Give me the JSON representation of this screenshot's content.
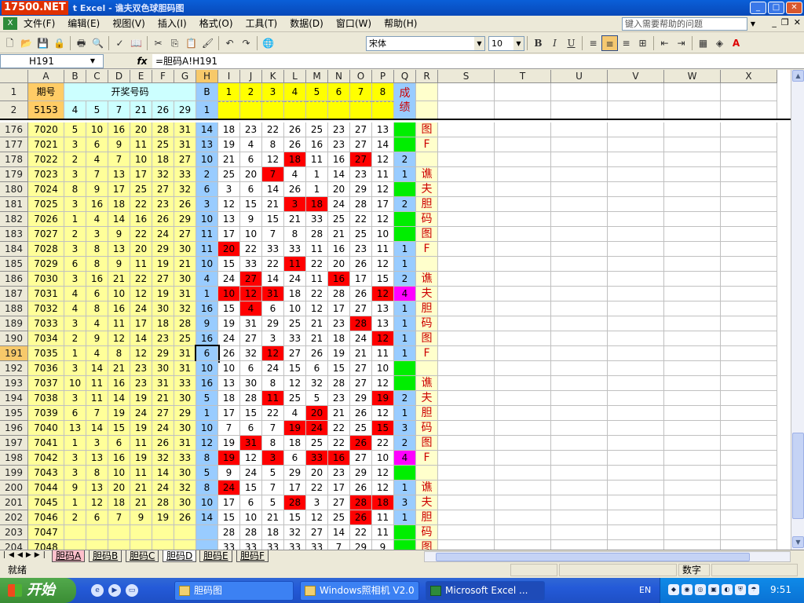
{
  "window": {
    "logo": "17500.NET",
    "title": "t Excel - 谯夫双色球胆码图"
  },
  "menu": [
    "文件(F)",
    "编辑(E)",
    "视图(V)",
    "插入(I)",
    "格式(O)",
    "工具(T)",
    "数据(D)",
    "窗口(W)",
    "帮助(H)"
  ],
  "help_placeholder": "键入需要帮助的问题",
  "toolbar": {
    "font": "宋体",
    "size": "10",
    "bold": "B",
    "italic": "I",
    "underline": "U"
  },
  "name_box": "H191",
  "fx_label": "fx",
  "formula": "=胆码A!H191",
  "col_headers": [
    "A",
    "B",
    "C",
    "D",
    "E",
    "F",
    "G",
    "H",
    "I",
    "J",
    "K",
    "L",
    "M",
    "N",
    "O",
    "P",
    "Q",
    "R",
    "S",
    "T",
    "U",
    "V",
    "W",
    "X"
  ],
  "header_rows": {
    "row1": {
      "num": "1",
      "label": "期号",
      "draw": "开奖号码",
      "H": "B",
      "I_P": [
        "1",
        "2",
        "3",
        "4",
        "5",
        "6",
        "7",
        "8"
      ],
      "Q": "成绩"
    },
    "row2": {
      "num": "2",
      "A": "5153",
      "B_G": [
        "4",
        "5",
        "7",
        "21",
        "26",
        "29"
      ],
      "H": "1"
    }
  },
  "rows": [
    {
      "n": "176",
      "a": "7020",
      "d": [
        "5",
        "10",
        "16",
        "20",
        "28",
        "31"
      ],
      "h": "14",
      "v": [
        "18",
        "23",
        "22",
        "26",
        "25",
        "23",
        "27",
        "13"
      ],
      "q": "",
      "r": "图"
    },
    {
      "n": "177",
      "a": "7021",
      "d": [
        "3",
        "6",
        "9",
        "11",
        "25",
        "31"
      ],
      "h": "13",
      "v": [
        "19",
        "4",
        "8",
        "26",
        "16",
        "23",
        "27",
        "14"
      ],
      "q": "",
      "r": "F"
    },
    {
      "n": "178",
      "a": "7022",
      "d": [
        "2",
        "4",
        "7",
        "10",
        "18",
        "27"
      ],
      "h": "10",
      "v": [
        "21",
        "6",
        "12",
        "18",
        "11",
        "16",
        "27",
        "12"
      ],
      "q": "2",
      "r": ""
    },
    {
      "n": "179",
      "a": "7023",
      "d": [
        "3",
        "7",
        "13",
        "17",
        "32",
        "33"
      ],
      "h": "2",
      "v": [
        "25",
        "20",
        "7",
        "4",
        "1",
        "14",
        "23",
        "11"
      ],
      "q": "1",
      "r": "谯"
    },
    {
      "n": "180",
      "a": "7024",
      "d": [
        "8",
        "9",
        "17",
        "25",
        "27",
        "32"
      ],
      "h": "6",
      "v": [
        "3",
        "6",
        "14",
        "26",
        "1",
        "20",
        "29",
        "12"
      ],
      "q": "",
      "r": "夫"
    },
    {
      "n": "181",
      "a": "7025",
      "d": [
        "3",
        "16",
        "18",
        "22",
        "23",
        "26"
      ],
      "h": "3",
      "v": [
        "12",
        "15",
        "21",
        "3",
        "18",
        "24",
        "28",
        "17"
      ],
      "q": "2",
      "r": "胆"
    },
    {
      "n": "182",
      "a": "7026",
      "d": [
        "1",
        "4",
        "14",
        "16",
        "26",
        "29"
      ],
      "h": "10",
      "v": [
        "13",
        "9",
        "15",
        "21",
        "33",
        "25",
        "22",
        "12"
      ],
      "q": "",
      "r": "码"
    },
    {
      "n": "183",
      "a": "7027",
      "d": [
        "2",
        "3",
        "9",
        "22",
        "24",
        "27"
      ],
      "h": "11",
      "v": [
        "17",
        "10",
        "7",
        "8",
        "28",
        "21",
        "25",
        "10"
      ],
      "q": "",
      "r": "图"
    },
    {
      "n": "184",
      "a": "7028",
      "d": [
        "3",
        "8",
        "13",
        "20",
        "29",
        "30"
      ],
      "h": "11",
      "v": [
        "20",
        "22",
        "33",
        "33",
        "11",
        "16",
        "23",
        "11"
      ],
      "q": "1",
      "r": "F"
    },
    {
      "n": "185",
      "a": "7029",
      "d": [
        "6",
        "8",
        "9",
        "11",
        "19",
        "21"
      ],
      "h": "10",
      "v": [
        "15",
        "33",
        "22",
        "11",
        "22",
        "20",
        "26",
        "12"
      ],
      "q": "1",
      "r": ""
    },
    {
      "n": "186",
      "a": "7030",
      "d": [
        "3",
        "16",
        "21",
        "22",
        "27",
        "30"
      ],
      "h": "4",
      "v": [
        "24",
        "27",
        "14",
        "24",
        "11",
        "16",
        "17",
        "15"
      ],
      "q": "2",
      "r": "谯"
    },
    {
      "n": "187",
      "a": "7031",
      "d": [
        "4",
        "6",
        "10",
        "12",
        "19",
        "31"
      ],
      "h": "1",
      "v": [
        "10",
        "12",
        "31",
        "18",
        "22",
        "28",
        "26",
        "12"
      ],
      "q": "4",
      "r": "夫"
    },
    {
      "n": "188",
      "a": "7032",
      "d": [
        "4",
        "8",
        "16",
        "24",
        "30",
        "32"
      ],
      "h": "16",
      "v": [
        "15",
        "4",
        "6",
        "10",
        "12",
        "17",
        "27",
        "13"
      ],
      "q": "1",
      "r": "胆"
    },
    {
      "n": "189",
      "a": "7033",
      "d": [
        "3",
        "4",
        "11",
        "17",
        "18",
        "28"
      ],
      "h": "9",
      "v": [
        "19",
        "31",
        "29",
        "25",
        "21",
        "23",
        "28",
        "13"
      ],
      "q": "1",
      "r": "码"
    },
    {
      "n": "190",
      "a": "7034",
      "d": [
        "2",
        "9",
        "12",
        "14",
        "23",
        "25"
      ],
      "h": "16",
      "v": [
        "24",
        "27",
        "3",
        "33",
        "21",
        "18",
        "24",
        "12"
      ],
      "q": "1",
      "r": "图"
    },
    {
      "n": "191",
      "a": "7035",
      "d": [
        "1",
        "4",
        "8",
        "12",
        "29",
        "31"
      ],
      "h": "6",
      "v": [
        "26",
        "32",
        "12",
        "27",
        "26",
        "19",
        "21",
        "11"
      ],
      "q": "1",
      "r": "F"
    },
    {
      "n": "192",
      "a": "7036",
      "d": [
        "3",
        "14",
        "21",
        "23",
        "30",
        "31"
      ],
      "h": "10",
      "v": [
        "10",
        "6",
        "24",
        "15",
        "6",
        "15",
        "27",
        "10"
      ],
      "q": "",
      "r": ""
    },
    {
      "n": "193",
      "a": "7037",
      "d": [
        "10",
        "11",
        "16",
        "23",
        "31",
        "33"
      ],
      "h": "16",
      "v": [
        "13",
        "30",
        "8",
        "12",
        "32",
        "28",
        "27",
        "12"
      ],
      "q": "",
      "r": "谯"
    },
    {
      "n": "194",
      "a": "7038",
      "d": [
        "3",
        "11",
        "14",
        "19",
        "21",
        "30"
      ],
      "h": "5",
      "v": [
        "18",
        "28",
        "11",
        "25",
        "5",
        "23",
        "29",
        "19"
      ],
      "q": "2",
      "r": "夫"
    },
    {
      "n": "195",
      "a": "7039",
      "d": [
        "6",
        "7",
        "19",
        "24",
        "27",
        "29"
      ],
      "h": "1",
      "v": [
        "17",
        "15",
        "22",
        "4",
        "20",
        "21",
        "26",
        "12"
      ],
      "q": "1",
      "r": "胆"
    },
    {
      "n": "196",
      "a": "7040",
      "d": [
        "13",
        "14",
        "15",
        "19",
        "24",
        "30"
      ],
      "h": "10",
      "v": [
        "7",
        "6",
        "7",
        "19",
        "24",
        "22",
        "25",
        "15"
      ],
      "q": "3",
      "r": "码"
    },
    {
      "n": "197",
      "a": "7041",
      "d": [
        "1",
        "3",
        "6",
        "11",
        "26",
        "31"
      ],
      "h": "12",
      "v": [
        "19",
        "31",
        "8",
        "18",
        "25",
        "22",
        "26",
        "22"
      ],
      "q": "2",
      "r": "图"
    },
    {
      "n": "198",
      "a": "7042",
      "d": [
        "3",
        "13",
        "16",
        "19",
        "32",
        "33"
      ],
      "h": "8",
      "v": [
        "19",
        "12",
        "3",
        "6",
        "33",
        "16",
        "27",
        "10"
      ],
      "q": "4",
      "r": "F"
    },
    {
      "n": "199",
      "a": "7043",
      "d": [
        "3",
        "8",
        "10",
        "11",
        "14",
        "30"
      ],
      "h": "5",
      "v": [
        "9",
        "24",
        "5",
        "29",
        "20",
        "23",
        "29",
        "12"
      ],
      "q": "",
      "r": ""
    },
    {
      "n": "200",
      "a": "7044",
      "d": [
        "9",
        "13",
        "20",
        "21",
        "24",
        "32"
      ],
      "h": "8",
      "v": [
        "24",
        "15",
        "7",
        "17",
        "22",
        "17",
        "26",
        "12"
      ],
      "q": "1",
      "r": "谯"
    },
    {
      "n": "201",
      "a": "7045",
      "d": [
        "1",
        "12",
        "18",
        "21",
        "28",
        "30"
      ],
      "h": "10",
      "v": [
        "17",
        "6",
        "5",
        "28",
        "3",
        "27",
        "28",
        "18"
      ],
      "q": "3",
      "r": "夫"
    },
    {
      "n": "202",
      "a": "7046",
      "d": [
        "2",
        "6",
        "7",
        "9",
        "19",
        "26"
      ],
      "h": "14",
      "v": [
        "15",
        "10",
        "21",
        "15",
        "12",
        "25",
        "26",
        "11"
      ],
      "q": "1",
      "r": "胆"
    },
    {
      "n": "203",
      "a": "7047",
      "d": [
        "",
        "",
        "",
        "",
        "",
        ""
      ],
      "h": "",
      "v": [
        "28",
        "28",
        "18",
        "32",
        "27",
        "14",
        "22",
        "11"
      ],
      "q": "",
      "r": "码"
    },
    {
      "n": "204",
      "a": "7048",
      "d": [
        "",
        "",
        "",
        "",
        "",
        ""
      ],
      "h": "",
      "v": [
        "33",
        "33",
        "33",
        "33",
        "33",
        "7",
        "29",
        "9"
      ],
      "q": "",
      "r": "图"
    }
  ],
  "highlights": {
    "178": [
      3,
      6
    ],
    "179": [
      2
    ],
    "181": [
      3,
      4
    ],
    "184": [
      0
    ],
    "185": [
      3
    ],
    "186": [
      1,
      5
    ],
    "187": [
      0,
      1,
      2,
      7
    ],
    "188": [
      1
    ],
    "189": [
      6
    ],
    "190": [
      7
    ],
    "191": [
      2
    ],
    "194": [
      2,
      7
    ],
    "195": [
      4
    ],
    "196": [
      3,
      4,
      7
    ],
    "197": [
      1,
      6
    ],
    "198": [
      0,
      2,
      4,
      5
    ],
    "200": [
      0
    ],
    "201": [
      3,
      6,
      7
    ],
    "202": [
      6
    ]
  },
  "q_magenta": [
    "187",
    "198"
  ],
  "q_green": [
    "176",
    "177",
    "180",
    "182",
    "183",
    "192",
    "193",
    "199",
    "203",
    "204"
  ],
  "colors": {
    "yellow": "#ffff99",
    "brightYellow": "#ffff00",
    "cyan": "#ccffff",
    "blue": "#99ccff",
    "red": "#ff0000",
    "green": "#00ee00",
    "magenta": "#ff00ff",
    "orange": "#ffcc66",
    "text_red": "#cc0000",
    "r_bg": "#ffffcc"
  },
  "sheet_tabs": [
    "胆码A",
    "胆码B",
    "胆码C",
    "胆码D",
    "胆码E",
    "胆码F"
  ],
  "active_tab": "胆码D",
  "status": {
    "ready": "就绪",
    "mode": "数字"
  },
  "taskbar": {
    "start": "开始",
    "buttons": [
      "胆码图",
      "Windows照相机 V2.0",
      "Microsoft Excel ..."
    ],
    "lang": "EN",
    "clock": "9:51"
  }
}
